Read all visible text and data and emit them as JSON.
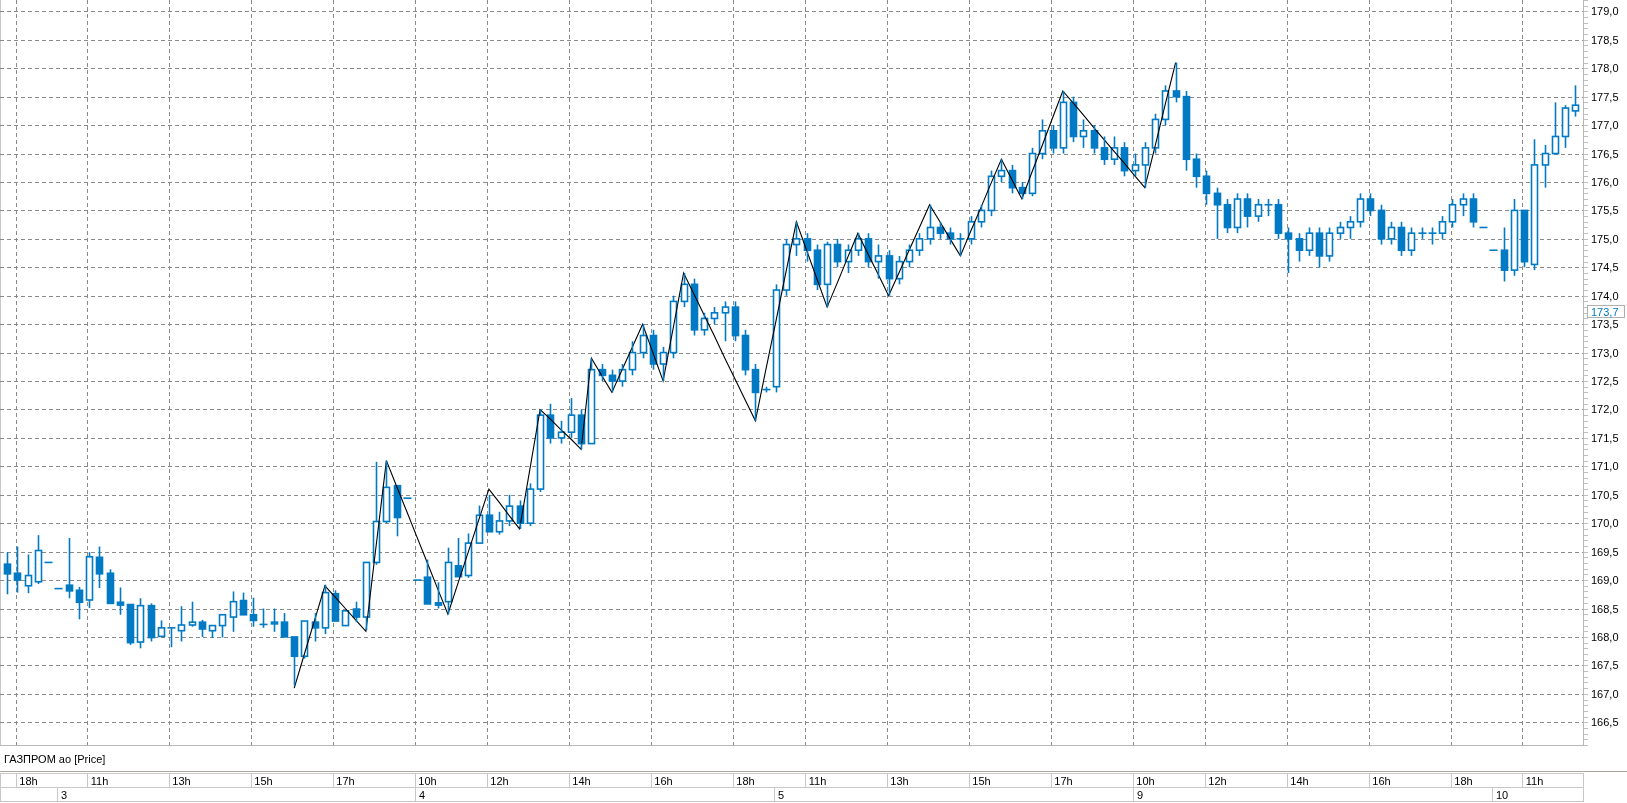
{
  "chart_data": {
    "type": "candlestick",
    "title": "ГАЗПРОМ ао [Price]",
    "grid": true,
    "ylim": [
      166.1,
      179.2
    ],
    "yticks": [
      {
        "value": 166.5,
        "label": "166,5"
      },
      {
        "value": 167,
        "label": "167,0"
      },
      {
        "value": 167.5,
        "label": "167,5"
      },
      {
        "value": 168,
        "label": "168,0"
      },
      {
        "value": 168.5,
        "label": "168,5"
      },
      {
        "value": 169,
        "label": "169,0"
      },
      {
        "value": 169.5,
        "label": "169,5"
      },
      {
        "value": 170,
        "label": "170,0"
      },
      {
        "value": 170.5,
        "label": "170,5"
      },
      {
        "value": 171,
        "label": "171,0"
      },
      {
        "value": 171.5,
        "label": "171,5"
      },
      {
        "value": 172,
        "label": "172,0"
      },
      {
        "value": 172.5,
        "label": "172,5"
      },
      {
        "value": 173,
        "label": "173,0"
      },
      {
        "value": 173.5,
        "label": "173,5"
      },
      {
        "value": 174,
        "label": "174,0"
      },
      {
        "value": 174.5,
        "label": "174,5"
      },
      {
        "value": 175,
        "label": "175,0"
      },
      {
        "value": 175.5,
        "label": "175,5"
      },
      {
        "value": 176,
        "label": "176,0"
      },
      {
        "value": 176.5,
        "label": "176,5"
      },
      {
        "value": 177,
        "label": "177,0"
      },
      {
        "value": 177.5,
        "label": "177,5"
      },
      {
        "value": 178,
        "label": "178,0"
      },
      {
        "value": 178.5,
        "label": "178,5"
      },
      {
        "value": 179,
        "label": "179,0"
      }
    ],
    "categories": [
      null,
      null,
      "18h",
      null,
      null,
      null,
      null,
      null,
      null,
      "11h",
      null,
      null,
      null,
      null,
      null,
      null,
      null,
      "13h",
      null,
      null,
      null,
      null,
      null,
      null,
      null,
      "15h",
      null,
      null,
      null,
      null,
      null,
      null,
      null,
      "17h",
      null,
      null,
      null,
      null,
      null,
      null,
      null,
      "10h",
      null,
      null,
      null,
      null,
      null,
      null,
      "12h",
      null,
      null,
      null,
      null,
      null,
      null,
      null,
      "14h",
      null,
      null,
      null,
      null,
      null,
      null,
      null,
      "16h",
      null,
      null,
      null,
      null,
      null,
      null,
      null,
      "18h",
      null,
      null,
      null,
      null,
      null,
      null,
      "11h",
      null,
      null,
      null,
      null,
      null,
      null,
      null,
      "13h",
      null,
      null,
      null,
      null,
      null,
      null,
      null,
      "15h",
      null,
      null,
      null,
      null,
      null,
      null,
      null,
      "17h",
      null,
      null,
      null,
      null,
      null,
      null,
      null,
      "10h",
      null,
      null,
      null,
      null,
      null,
      null,
      "12h",
      null,
      null,
      null,
      null,
      null,
      null,
      null,
      "14h",
      null,
      null,
      null,
      null,
      null,
      null,
      null,
      "16h",
      null,
      null,
      null,
      null,
      null,
      null,
      null,
      "18h",
      null,
      null,
      null,
      null,
      null,
      null,
      "11h",
      null,
      null,
      null,
      null
    ],
    "annotations": [
      "173,7"
    ],
    "ohlc": [
      [
        169.28,
        169.49,
        168.75,
        169.11
      ],
      [
        169.12,
        169.59,
        168.78,
        169.0
      ],
      [
        168.9,
        169.45,
        168.77,
        169.08
      ],
      [
        168.97,
        169.79,
        168.93,
        169.52
      ],
      [
        169.31,
        169.31,
        169.31,
        169.31
      ],
      [
        168.85,
        168.85,
        168.85,
        168.85
      ],
      [
        168.91,
        169.74,
        168.68,
        168.81
      ],
      [
        168.82,
        168.88,
        168.31,
        168.61
      ],
      [
        168.65,
        169.49,
        168.51,
        169.41
      ],
      [
        169.4,
        169.59,
        168.86,
        169.11
      ],
      [
        169.12,
        169.19,
        168.58,
        168.59
      ],
      [
        168.61,
        168.87,
        168.39,
        168.56
      ],
      [
        168.57,
        168.58,
        167.86,
        167.9
      ],
      [
        167.91,
        168.68,
        167.8,
        168.55
      ],
      [
        168.55,
        168.59,
        167.92,
        167.99
      ],
      [
        168.01,
        168.29,
        167.99,
        168.16
      ],
      [
        168.16,
        168.17,
        167.82,
        168.16
      ],
      [
        168.11,
        168.54,
        167.92,
        168.21
      ],
      [
        168.21,
        168.62,
        168.18,
        168.26
      ],
      [
        168.26,
        168.3,
        168.0,
        168.14
      ],
      [
        168.11,
        168.2,
        167.98,
        168.2
      ],
      [
        168.2,
        168.39,
        167.99,
        168.39
      ],
      [
        168.35,
        168.8,
        168.09,
        168.62
      ],
      [
        168.64,
        168.78,
        168.39,
        168.39
      ],
      [
        168.39,
        168.69,
        168.18,
        168.29
      ],
      [
        168.22,
        168.5,
        168.16,
        168.22
      ],
      [
        168.23,
        168.5,
        168.09,
        168.26
      ],
      [
        168.26,
        168.42,
        168.0,
        168.0
      ],
      [
        168.0,
        168.0,
        167.14,
        167.66
      ],
      [
        167.66,
        168.28,
        167.62,
        168.28
      ],
      [
        168.26,
        168.42,
        167.92,
        168.16
      ],
      [
        168.16,
        168.92,
        168.05,
        168.78
      ],
      [
        168.76,
        168.82,
        168.28,
        168.28
      ],
      [
        168.2,
        168.46,
        168.2,
        168.46
      ],
      [
        168.49,
        168.62,
        168.26,
        168.35
      ],
      [
        168.35,
        169.31,
        168.12,
        169.31
      ],
      [
        169.31,
        171.08,
        169.27,
        170.03
      ],
      [
        170.03,
        171.1,
        170.0,
        170.63
      ],
      [
        170.66,
        170.66,
        169.77,
        170.1
      ],
      [
        170.44,
        170.44,
        170.44,
        170.44
      ],
      [
        169.0,
        169.0,
        169.0,
        169.0
      ],
      [
        169.05,
        169.36,
        168.58,
        168.58
      ],
      [
        168.6,
        168.96,
        168.5,
        168.56
      ],
      [
        168.62,
        169.57,
        168.4,
        169.31
      ],
      [
        169.25,
        169.74,
        169.06,
        169.06
      ],
      [
        169.08,
        169.82,
        169.04,
        169.65
      ],
      [
        169.65,
        170.31,
        169.65,
        170.14
      ],
      [
        170.14,
        170.5,
        169.85,
        169.85
      ],
      [
        169.85,
        170.2,
        169.8,
        170.04
      ],
      [
        170.04,
        170.5,
        169.95,
        170.3
      ],
      [
        170.3,
        170.4,
        169.9,
        170.0
      ],
      [
        170.0,
        170.7,
        169.95,
        170.6
      ],
      [
        170.6,
        172.0,
        170.55,
        171.9
      ],
      [
        171.9,
        172.1,
        171.4,
        171.5
      ],
      [
        171.5,
        171.8,
        171.4,
        171.6
      ],
      [
        171.6,
        172.2,
        171.5,
        171.9
      ],
      [
        171.9,
        172.0,
        171.3,
        171.4
      ],
      [
        171.4,
        172.9,
        171.4,
        172.7
      ],
      [
        172.7,
        172.8,
        172.5,
        172.6
      ],
      [
        172.6,
        172.7,
        172.3,
        172.5
      ],
      [
        172.5,
        172.8,
        172.4,
        172.7
      ],
      [
        172.7,
        173.2,
        172.6,
        173.0
      ],
      [
        173.0,
        173.5,
        172.9,
        173.3
      ],
      [
        173.3,
        173.4,
        172.7,
        172.8
      ],
      [
        172.8,
        173.1,
        172.5,
        173.0
      ],
      [
        173.0,
        174.0,
        172.9,
        173.9
      ],
      [
        173.9,
        174.4,
        173.8,
        174.2
      ],
      [
        174.2,
        174.3,
        173.3,
        173.4
      ],
      [
        173.4,
        173.7,
        173.3,
        173.6
      ],
      [
        173.6,
        173.8,
        173.5,
        173.7
      ],
      [
        173.7,
        173.9,
        173.2,
        173.8
      ],
      [
        173.8,
        173.9,
        173.2,
        173.3
      ],
      [
        173.3,
        173.4,
        172.6,
        172.7
      ],
      [
        172.7,
        172.8,
        171.8,
        172.3
      ],
      [
        172.35,
        172.4,
        172.3,
        172.35
      ],
      [
        172.4,
        174.2,
        172.3,
        174.1
      ],
      [
        174.1,
        175.0,
        174.0,
        174.9
      ],
      [
        174.9,
        175.3,
        174.7,
        175.0
      ],
      [
        175.0,
        175.1,
        174.6,
        174.8
      ],
      [
        174.8,
        174.9,
        174.1,
        174.2
      ],
      [
        174.2,
        174.95,
        173.8,
        174.9
      ],
      [
        174.9,
        175.0,
        174.5,
        174.6
      ],
      [
        174.6,
        174.9,
        174.4,
        174.8
      ],
      [
        174.8,
        175.1,
        174.7,
        175.0
      ],
      [
        175.0,
        175.1,
        174.5,
        174.6
      ],
      [
        174.6,
        174.9,
        174.3,
        174.7
      ],
      [
        174.7,
        174.8,
        174.0,
        174.3
      ],
      [
        174.3,
        174.7,
        174.2,
        174.6
      ],
      [
        174.6,
        174.9,
        174.5,
        174.8
      ],
      [
        174.8,
        175.1,
        174.7,
        175.0
      ],
      [
        175.0,
        175.6,
        174.9,
        175.2
      ],
      [
        175.2,
        175.3,
        175.0,
        175.1
      ],
      [
        175.1,
        175.2,
        174.9,
        175.0
      ],
      [
        175.0,
        175.1,
        174.7,
        175.0
      ],
      [
        175.0,
        175.4,
        174.9,
        175.3
      ],
      [
        175.3,
        175.6,
        175.2,
        175.5
      ],
      [
        175.5,
        176.2,
        175.4,
        176.1
      ],
      [
        176.1,
        176.4,
        176.0,
        176.2
      ],
      [
        176.2,
        176.3,
        175.8,
        175.9
      ],
      [
        175.9,
        176.0,
        175.7,
        175.8
      ],
      [
        175.8,
        176.6,
        175.75,
        176.5
      ],
      [
        176.5,
        177.1,
        176.4,
        176.9
      ],
      [
        176.9,
        177.0,
        176.5,
        176.6
      ],
      [
        176.6,
        177.6,
        176.5,
        177.4
      ],
      [
        177.4,
        177.5,
        176.7,
        176.8
      ],
      [
        176.8,
        177.1,
        176.6,
        176.9
      ],
      [
        176.9,
        177.0,
        176.5,
        176.6
      ],
      [
        176.6,
        176.8,
        176.3,
        176.4
      ],
      [
        176.4,
        176.8,
        176.3,
        176.6
      ],
      [
        176.6,
        176.7,
        176.1,
        176.2
      ],
      [
        176.2,
        176.5,
        176.1,
        176.3
      ],
      [
        176.3,
        176.7,
        175.9,
        176.6
      ],
      [
        176.6,
        177.2,
        176.5,
        177.1
      ],
      [
        177.1,
        177.7,
        177.0,
        177.6
      ],
      [
        177.6,
        178.1,
        177.4,
        177.5
      ],
      [
        177.5,
        177.6,
        176.2,
        176.4
      ],
      [
        176.4,
        176.5,
        175.9,
        176.1
      ],
      [
        176.1,
        176.2,
        175.6,
        175.8
      ],
      [
        175.8,
        175.9,
        175.0,
        175.6
      ],
      [
        175.6,
        175.7,
        175.1,
        175.2
      ],
      [
        175.2,
        175.8,
        175.1,
        175.7
      ],
      [
        175.7,
        175.8,
        175.2,
        175.4
      ],
      [
        175.4,
        175.7,
        175.3,
        175.6
      ],
      [
        175.6,
        175.7,
        175.4,
        175.6
      ],
      [
        175.6,
        175.7,
        175.0,
        175.1
      ],
      [
        175.1,
        175.2,
        174.4,
        175.0
      ],
      [
        175.0,
        175.1,
        174.6,
        174.8
      ],
      [
        174.8,
        175.2,
        174.7,
        175.1
      ],
      [
        175.1,
        175.2,
        174.5,
        174.7
      ],
      [
        174.7,
        175.2,
        174.6,
        175.1
      ],
      [
        175.1,
        175.3,
        175.0,
        175.2
      ],
      [
        175.2,
        175.4,
        175.0,
        175.3
      ],
      [
        175.3,
        175.8,
        175.2,
        175.7
      ],
      [
        175.7,
        175.8,
        175.4,
        175.5
      ],
      [
        175.5,
        175.6,
        174.9,
        175.0
      ],
      [
        175.0,
        175.3,
        174.9,
        175.2
      ],
      [
        175.2,
        175.3,
        174.7,
        174.8
      ],
      [
        174.8,
        175.2,
        174.7,
        175.1
      ],
      [
        175.1,
        175.2,
        175.0,
        175.1
      ],
      [
        175.1,
        175.2,
        174.9,
        175.1
      ],
      [
        175.1,
        175.4,
        175.0,
        175.3
      ],
      [
        175.3,
        175.7,
        175.2,
        175.6
      ],
      [
        175.6,
        175.8,
        175.4,
        175.7
      ],
      [
        175.7,
        175.8,
        175.2,
        175.3
      ],
      [
        175.2,
        175.2,
        175.2,
        175.2
      ],
      [
        174.8,
        174.8,
        174.8,
        174.8
      ],
      [
        174.8,
        175.2,
        174.25,
        174.45
      ],
      [
        174.45,
        175.7,
        174.35,
        175.5
      ],
      [
        175.5,
        175.5,
        174.5,
        174.6
      ],
      [
        174.55,
        176.75,
        174.45,
        176.3
      ],
      [
        176.3,
        176.65,
        175.9,
        176.5
      ],
      [
        176.5,
        177.4,
        176.5,
        176.8
      ],
      [
        176.8,
        177.35,
        176.6,
        177.3
      ],
      [
        177.25,
        177.7,
        177.15,
        177.35
      ]
    ],
    "series": [
      {
        "type": "line",
        "color": "#000000",
        "values": [
          null,
          null,
          null,
          null,
          null,
          null,
          null,
          null,
          null,
          null,
          null,
          null,
          null,
          null,
          null,
          null,
          null,
          null,
          null,
          null,
          null,
          null,
          null,
          null,
          null,
          null,
          null,
          null,
          167.1,
          167.7,
          168.3,
          168.9,
          168.7,
          168.5,
          168.3,
          168.1,
          169.6,
          171.1,
          170.65,
          170.2,
          169.75,
          169.3,
          168.85,
          168.4,
          168.95,
          169.5,
          170.05,
          170.6,
          170.37,
          170.13,
          169.9,
          170.95,
          172.0,
          171.83,
          171.65,
          171.48,
          171.3,
          172.9,
          172.6,
          172.3,
          172.7,
          173.1,
          173.5,
          173.0,
          172.5,
          173.45,
          174.4,
          174.03,
          173.66,
          173.29,
          172.91,
          172.54,
          172.17,
          171.8,
          172.68,
          173.55,
          174.43,
          175.3,
          174.8,
          174.3,
          173.8,
          174.23,
          174.67,
          175.1,
          174.73,
          174.37,
          174.0,
          174.4,
          174.8,
          175.2,
          175.6,
          175.3,
          175.0,
          174.7,
          175.13,
          175.55,
          175.98,
          176.4,
          176.05,
          175.7,
          176.18,
          176.65,
          177.13,
          177.6,
          177.39,
          177.18,
          176.96,
          176.75,
          176.54,
          176.33,
          176.11,
          175.9,
          176.63,
          177.37,
          178.1,
          null,
          null,
          null,
          null,
          null,
          null,
          null,
          null,
          null,
          null,
          null,
          null,
          null,
          null,
          null,
          null,
          null,
          null,
          null,
          null,
          null,
          null,
          null,
          null,
          null,
          null,
          null,
          null,
          null,
          null,
          null,
          null,
          null,
          null,
          null,
          null,
          null,
          null,
          null
        ]
      }
    ]
  },
  "time_axis": {
    "dates": [
      "3",
      "4",
      "5",
      "9",
      "10"
    ]
  }
}
